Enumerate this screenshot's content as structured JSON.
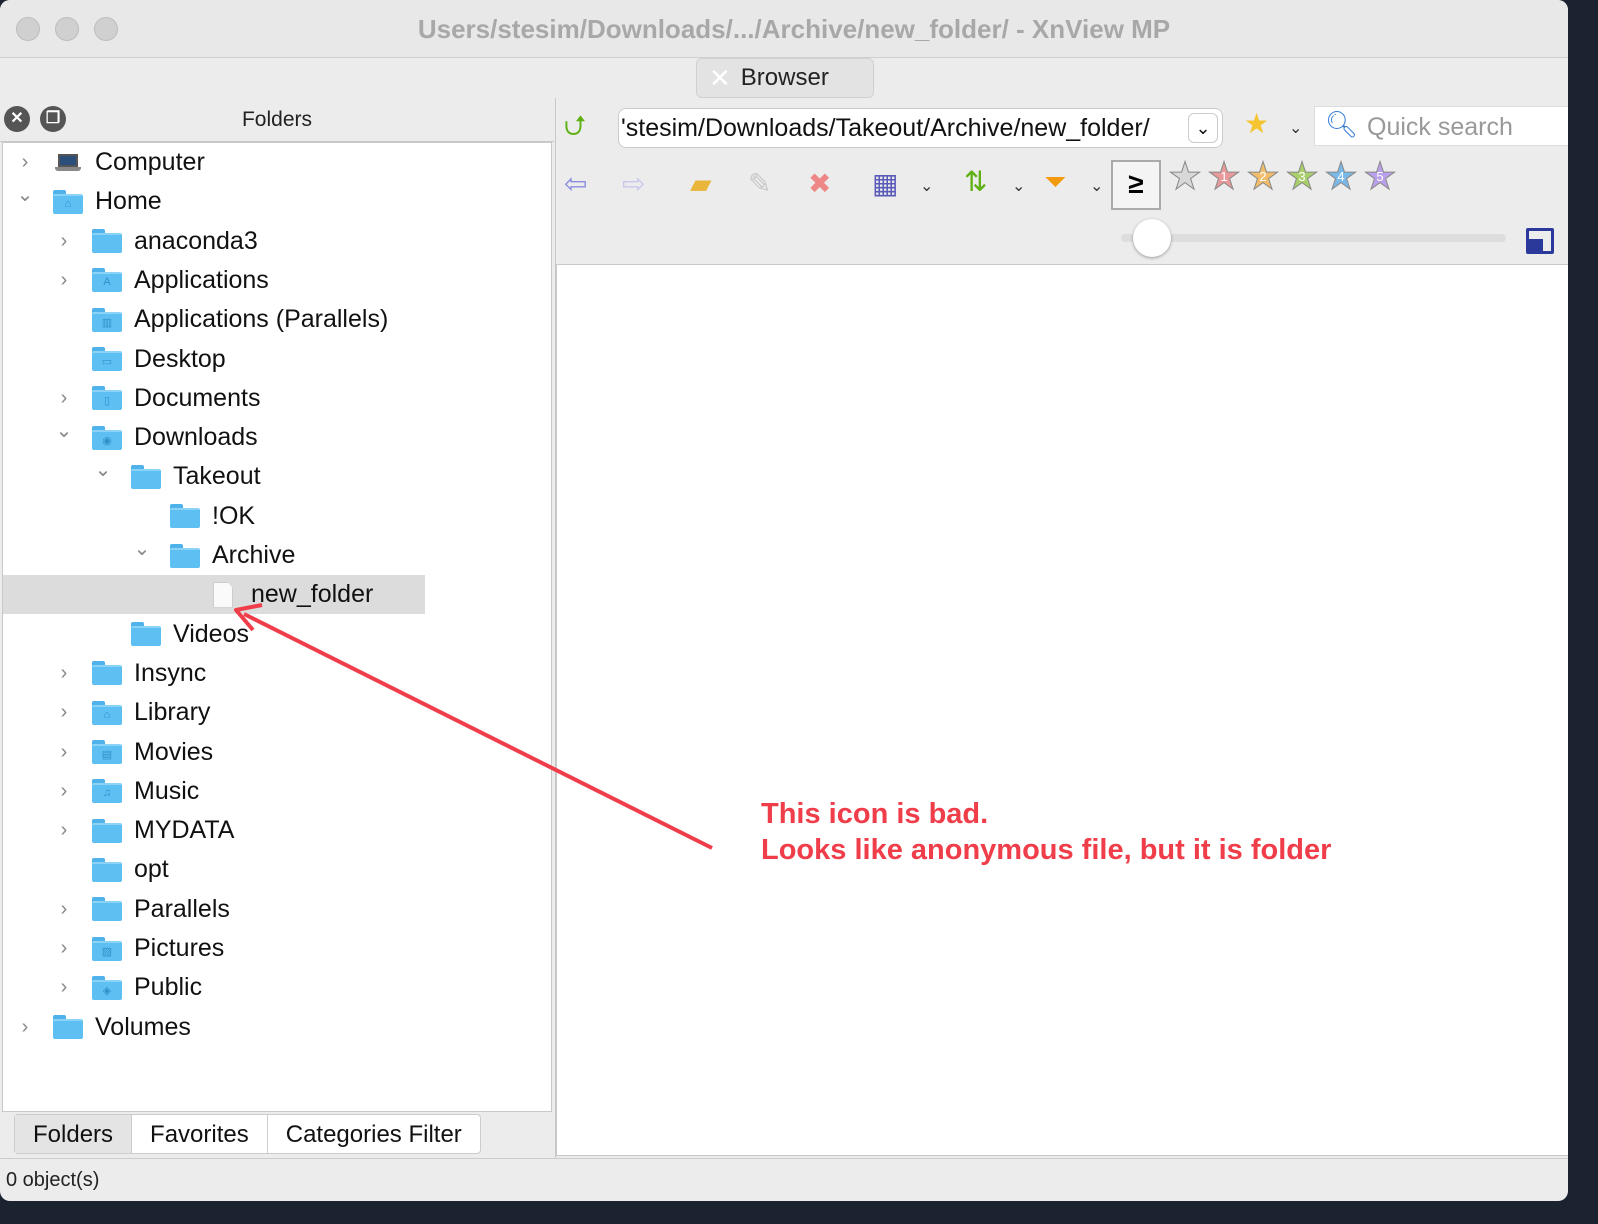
{
  "window": {
    "title": "Users/stesim/Downloads/.../Archive/new_folder/ - XnView MP",
    "tab": "Browser"
  },
  "left_panel": {
    "title": "Folders",
    "tree": [
      {
        "label": "Computer",
        "depth": 0,
        "expanded": false,
        "icon": "computer-icon"
      },
      {
        "label": "Home",
        "depth": 0,
        "expanded": true,
        "icon": "home-folder-icon",
        "glyph": "⌂"
      },
      {
        "label": "anaconda3",
        "depth": 1,
        "expanded": false,
        "icon": "folder-icon"
      },
      {
        "label": "Applications",
        "depth": 1,
        "expanded": false,
        "icon": "applications-folder-icon",
        "glyph": "A"
      },
      {
        "label": "Applications (Parallels)",
        "depth": 1,
        "expanded": null,
        "icon": "parallels-folder-icon",
        "glyph": "▥"
      },
      {
        "label": "Desktop",
        "depth": 1,
        "expanded": null,
        "icon": "desktop-folder-icon",
        "glyph": "▭"
      },
      {
        "label": "Documents",
        "depth": 1,
        "expanded": false,
        "icon": "documents-folder-icon",
        "glyph": "▯"
      },
      {
        "label": "Downloads",
        "depth": 1,
        "expanded": true,
        "icon": "downloads-folder-icon",
        "glyph": "◉"
      },
      {
        "label": "Takeout",
        "depth": 2,
        "expanded": true,
        "icon": "folder-icon"
      },
      {
        "label": "!OK",
        "depth": 3,
        "expanded": null,
        "icon": "folder-icon"
      },
      {
        "label": "Archive",
        "depth": 3,
        "expanded": true,
        "icon": "folder-icon"
      },
      {
        "label": "new_folder",
        "depth": 4,
        "expanded": null,
        "icon": "file-icon",
        "selected": true
      },
      {
        "label": "Videos",
        "depth": 2,
        "expanded": null,
        "icon": "folder-icon"
      },
      {
        "label": "Insync",
        "depth": 1,
        "expanded": false,
        "icon": "folder-icon"
      },
      {
        "label": "Library",
        "depth": 1,
        "expanded": false,
        "icon": "library-folder-icon",
        "glyph": "⌂"
      },
      {
        "label": "Movies",
        "depth": 1,
        "expanded": false,
        "icon": "movies-folder-icon",
        "glyph": "▤"
      },
      {
        "label": "Music",
        "depth": 1,
        "expanded": false,
        "icon": "music-folder-icon",
        "glyph": "♫"
      },
      {
        "label": "MYDATA",
        "depth": 1,
        "expanded": false,
        "icon": "folder-icon"
      },
      {
        "label": "opt",
        "depth": 1,
        "expanded": null,
        "icon": "folder-icon"
      },
      {
        "label": "Parallels",
        "depth": 1,
        "expanded": false,
        "icon": "folder-icon"
      },
      {
        "label": "Pictures",
        "depth": 1,
        "expanded": false,
        "icon": "pictures-folder-icon",
        "glyph": "▨"
      },
      {
        "label": "Public",
        "depth": 1,
        "expanded": false,
        "icon": "public-folder-icon",
        "glyph": "◈"
      },
      {
        "label": "Volumes",
        "depth": 0,
        "expanded": false,
        "icon": "folder-icon"
      }
    ],
    "bottom_tabs": [
      "Folders",
      "Favorites",
      "Categories Filter"
    ]
  },
  "toolbar": {
    "address": "'stesim/Downloads/Takeout/Archive/new_folder/",
    "search_placeholder": "Quick search",
    "rating_operator": "≥",
    "rating_stars": [
      "",
      "1",
      "2",
      "3",
      "4",
      "5"
    ],
    "star_colors": [
      "#d8d8d8",
      "#e89a9a",
      "#f2bd6a",
      "#a9cf6a",
      "#7ab8e8",
      "#b8a0ea"
    ],
    "thumb_size": 0.08
  },
  "status": {
    "text": "0 object(s)"
  },
  "annotation": {
    "line1": "This icon is bad.",
    "line2": "Looks like anonymous file, but it is folder",
    "color": "#ef3d4a"
  }
}
